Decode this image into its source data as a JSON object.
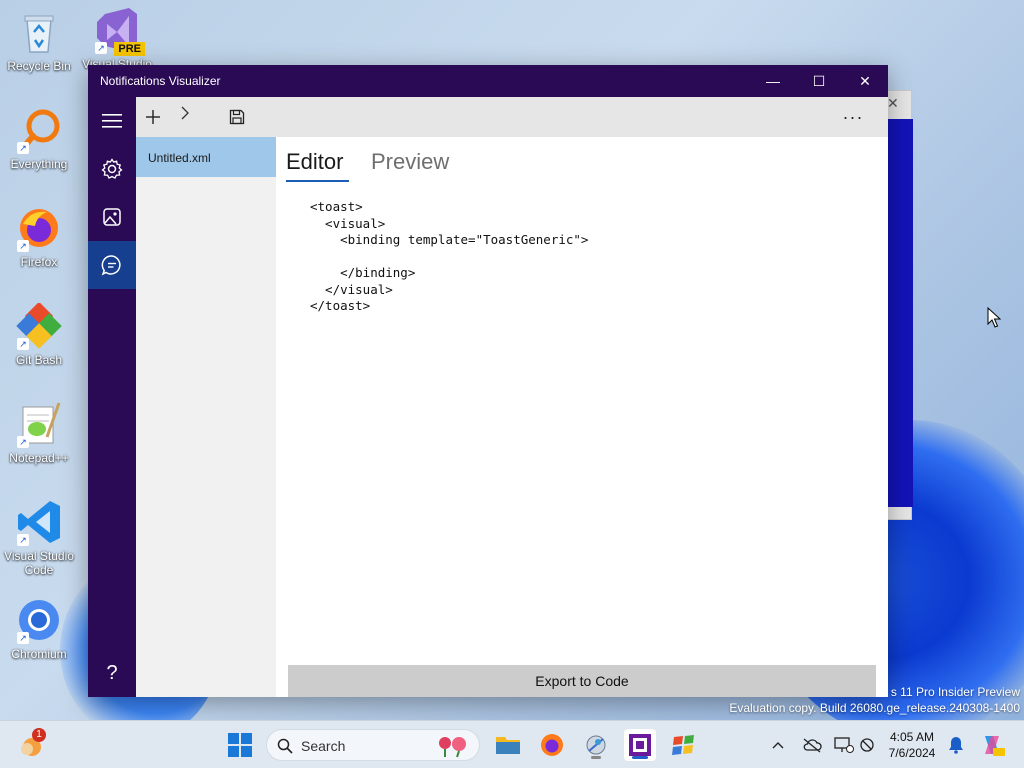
{
  "desktop": {
    "icons": [
      {
        "label": "Recycle Bin",
        "icon": "recycle-bin-icon"
      },
      {
        "label": "Visual Studio",
        "badge": "PRE",
        "icon": "visual-studio-icon"
      },
      {
        "label": "Everything",
        "icon": "everything-search-icon"
      },
      {
        "label": "Firefox",
        "icon": "firefox-icon"
      },
      {
        "label": "Git Bash",
        "icon": "git-bash-icon"
      },
      {
        "label": "Notepad++",
        "icon": "notepad-plus-plus-icon"
      },
      {
        "label": "Visual Studio Code",
        "icon": "vscode-icon"
      },
      {
        "label": "Chromium",
        "icon": "chromium-icon"
      }
    ],
    "watermark": {
      "line1": "s 11 Pro Insider Preview",
      "line2": "Evaluation copy. Build 26080.ge_release.240308-1400"
    }
  },
  "app": {
    "title": "Notifications Visualizer",
    "window_controls": {
      "minimize": "—",
      "maximize": "☐",
      "close": "✕"
    },
    "file": {
      "name": "Untitled.xml"
    },
    "tabs": [
      {
        "label": "Editor",
        "active": true
      },
      {
        "label": "Preview",
        "active": false
      }
    ],
    "code": "<toast>\n  <visual>\n    <binding template=\"ToastGeneric\">\n\n    </binding>\n  </visual>\n</toast>",
    "export_button": "Export to Code",
    "nav": [
      "hamburger-menu-icon",
      "settings-gear-icon",
      "image-icon",
      "chat-bubble-icon",
      "help-icon"
    ],
    "help_label": "?",
    "more_label": "···"
  },
  "taskbar": {
    "search_placeholder": "Search",
    "notification_count": "1",
    "time": "4:05 AM",
    "date": "7/6/2024"
  },
  "colors": {
    "titlebar": "#2a0a55",
    "nav_active": "#163f8f",
    "file_selected": "#9ec7ea",
    "accent": "#1a5fb4"
  }
}
